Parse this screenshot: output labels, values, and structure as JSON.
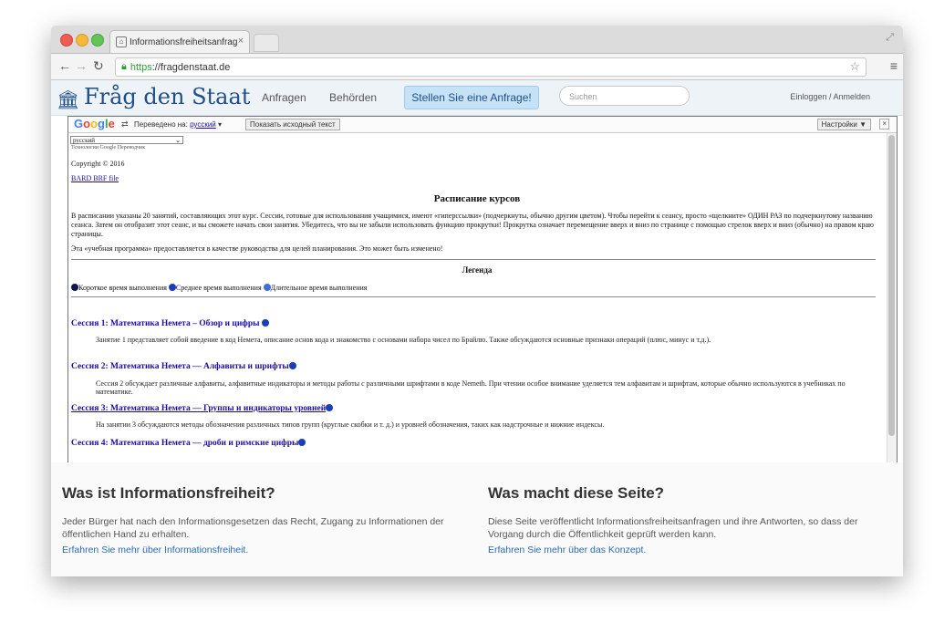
{
  "browser": {
    "tab_title": "Informationsfreiheitsanfrag",
    "tab_close": "×",
    "url_scheme": "https",
    "url_rest": "://fragdenstaat.de"
  },
  "site": {
    "logo": "Fråg den Staat",
    "nav": [
      "Anfragen",
      "Behörden"
    ],
    "cta": "Stellen Sie eine Anfrage!",
    "search_placeholder": "Suchen",
    "login": "Einloggen / Anmelden"
  },
  "translate_bar": {
    "brand": "Google",
    "translated_to": "Переведено на:",
    "language": "русский",
    "show_original": "Показать исходный текст",
    "settings": "Настройки ▼",
    "close": "×",
    "select_value": "русский",
    "powered_by": "Технологии Google Переводчик"
  },
  "doc": {
    "copyright": "Copyright © 2016",
    "braille_link": "BARD BRF file",
    "title": "Расписание курсов",
    "intro": "В расписании указаны 20 занятий, составляющих этот курс. Сессии, готовые для использования учащимися, имеют «гиперссылки» (подчеркнуты, обычно другим цветом). Чтобы перейти к сеансу, просто «щелкните» ОДИН РАЗ по подчеркнутому названию сеанса. Затем он отобразит этот сеанс, и вы сможете начать свои занятия. Убедитесь, что вы не забыли использовать функцию прокрутки! Прокрутка означает перемещение вверх и вниз по странице с помощью стрелок вверх и вниз (обычно) на правом краю страницы.",
    "note": "Эта «учебная программа» предоставляется в качестве руководства для целей планирования. Это может быть изменено!",
    "legend_title": "Легенда",
    "legend": [
      "Короткое время выполнения",
      "Среднее время выполнения",
      "Длительное время выполнения"
    ],
    "sessions": [
      {
        "title": "Сессия 1: Математика Немета – Обзор и цифры",
        "desc": "Занятие 1 представляет собой введение в код Немета, описание основ кода и знакомство с основами набора чисел по Брайлю. Также обсуждаются основные признаки операций (плюс, минус и т.д.)."
      },
      {
        "title": "Сессия 2: Математика Немета — Алфавиты и шрифты",
        "desc": "Сессия 2 обсуждает различные алфавиты, алфавитные индикаторы и методы работы с различными шрифтами в коде Nemeth. При чтении особое внимание уделяется тем алфавитам и шрифтам, которые обычно используются в учебниках по математике."
      },
      {
        "title": "Сессия 3: Математика Немета — Группы и индикаторы уровней",
        "desc": "На занятии 3 обсуждаются методы обозначения различных типов групп (круглые скобки и т. д.) и уровней обозначения, таких как надстрочные и нижние индексы."
      },
      {
        "title": "Сессия 4: Математика Немета — дроби и римские цифры",
        "desc": ""
      }
    ]
  },
  "footer": {
    "col1_title": "Was ist Informationsfreiheit?",
    "col1_text": "Jeder Bürger hat nach den Informationsgesetzen das Recht, Zugang zu Informationen der öffentlichen Hand zu erhalten.",
    "col1_link": "Erfahren Sie mehr über Informationsfreiheit.",
    "col2_title": "Was macht diese Seite?",
    "col2_text": "Diese Seite veröffentlicht Informationsfreiheitsanfragen und ihre Antworten, so dass der Vorgang durch die Öffentlichkeit geprüft werden kann.",
    "col2_link": "Erfahren Sie mehr über das Konzept."
  },
  "colors": {
    "brand": "#1f4f86",
    "link": "#1a0dab",
    "cta_bg": "#c6e2f7"
  }
}
